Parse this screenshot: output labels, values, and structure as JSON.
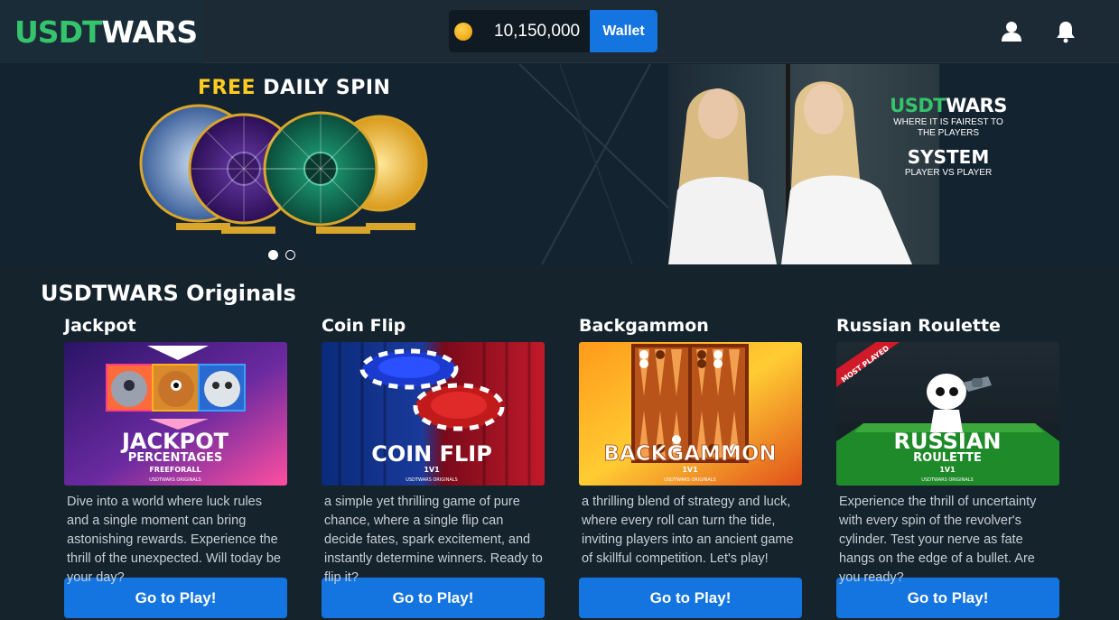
{
  "header": {
    "logo_green": "USDT",
    "logo_white": "WARS",
    "balance": "10,150,000",
    "wallet_label": "Wallet",
    "icons": [
      "coin-icon",
      "user-icon",
      "bell-icon"
    ]
  },
  "banner": {
    "promo_yellow": "FREE",
    "promo_white": "DAILY SPIN",
    "brand_green": "USDT",
    "brand_white": "WARS",
    "tagline_1": "WHERE IT IS FAIREST TO",
    "tagline_2": "THE PLAYERS",
    "system_title": "SYSTEM",
    "system_sub": "PLAYER VS PLAYER",
    "slides": [
      {
        "active": true
      },
      {
        "active": false
      }
    ]
  },
  "originals": {
    "title": "USDTWARS Originals",
    "games": [
      {
        "name": "Jackpot",
        "art_title": "JACKPOT",
        "art_sub": "PERCENTAGES",
        "art_sub2": "FREEFORALL",
        "art_brand": "USDTWARS ORIGINALS",
        "description": "Dive into a world where luck rules and a single moment can bring astonishing rewards. Experience the thrill of the unexpected. Will today be your day?",
        "button": "Go to Play!"
      },
      {
        "name": "Coin Flip",
        "art_title": "COIN FLIP",
        "art_sub": "1V1",
        "art_brand": "USDTWARS ORIGINALS",
        "description": "a simple yet thrilling game of pure chance, where a single flip can decide fates, spark excitement, and instantly determine winners. Ready to flip it?",
        "button": "Go to Play!"
      },
      {
        "name": "Backgammon",
        "art_title": "BACKGAMMON",
        "art_sub": "1V1",
        "art_brand": "USDTWARS ORIGINALS",
        "description": "a thrilling blend of strategy and luck, where every roll can turn the tide, inviting players into an ancient game of skillful competition. Let's play!",
        "button": "Go to Play!"
      },
      {
        "name": "Russian Roulette",
        "art_title": "RUSSIAN",
        "art_sub": "ROULETTE",
        "art_sub2": "1V1",
        "art_brand": "USDTWARS ORIGINALS",
        "art_ribbon": "MOST PLAYED",
        "description": "Experience the thrill of uncertainty with every spin of the revolver's cylinder. Test your nerve as fate hangs on the edge of a bullet. Are you ready?",
        "button": "Go to Play!"
      }
    ]
  }
}
